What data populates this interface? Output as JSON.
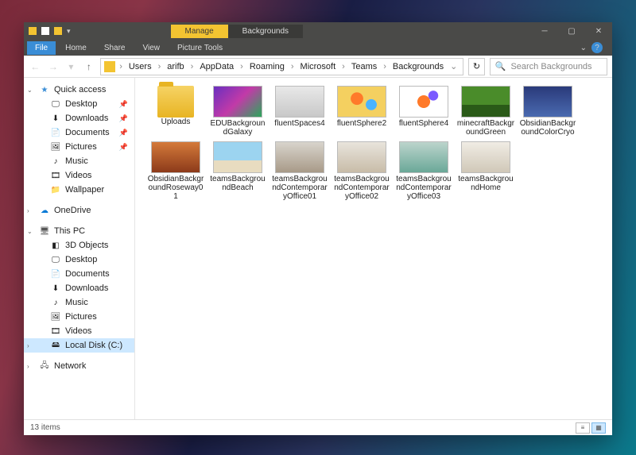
{
  "titlebar": {
    "manage": "Manage",
    "contextTab": "Backgrounds"
  },
  "ribbon": {
    "file": "File",
    "home": "Home",
    "share": "Share",
    "view": "View",
    "pictureTools": "Picture Tools"
  },
  "breadcrumb": [
    "Users",
    "arifb",
    "AppData",
    "Roaming",
    "Microsoft",
    "Teams",
    "Backgrounds"
  ],
  "search": {
    "placeholder": "Search Backgrounds"
  },
  "sidebar": {
    "quick": {
      "label": "Quick access",
      "items": [
        {
          "label": "Desktop",
          "pin": true
        },
        {
          "label": "Downloads",
          "pin": true
        },
        {
          "label": "Documents",
          "pin": true
        },
        {
          "label": "Pictures",
          "pin": true
        },
        {
          "label": "Music",
          "pin": false
        },
        {
          "label": "Videos",
          "pin": false
        },
        {
          "label": "Wallpaper",
          "pin": false
        }
      ]
    },
    "onedrive": "OneDrive",
    "thispc": {
      "label": "This PC",
      "items": [
        "3D Objects",
        "Desktop",
        "Documents",
        "Downloads",
        "Music",
        "Pictures",
        "Videos",
        "Local Disk (C:)"
      ]
    },
    "network": "Network"
  },
  "files": [
    {
      "name": "Uploads",
      "type": "folder"
    },
    {
      "name": "EDUBackgroundGalaxy",
      "tint": "t-galaxy"
    },
    {
      "name": "fluentSpaces4",
      "tint": "t-spaces"
    },
    {
      "name": "fluentSphere2",
      "tint": "t-sphere2"
    },
    {
      "name": "fluentSphere4",
      "tint": "t-sphere4"
    },
    {
      "name": "minecraftBackgroundGreen",
      "tint": "t-minecraft"
    },
    {
      "name": "ObsidianBackgroundColorCryo",
      "tint": "t-cryo"
    },
    {
      "name": "ObsidianBackgroundRoseway01",
      "tint": "t-rose"
    },
    {
      "name": "teamsBackgroundBeach",
      "tint": "t-beach"
    },
    {
      "name": "teamsBackgroundContemporaryOffice01",
      "tint": "t-off1"
    },
    {
      "name": "teamsBackgroundContemporaryOffice02",
      "tint": "t-off2"
    },
    {
      "name": "teamsBackgroundContemporaryOffice03",
      "tint": "t-off3"
    },
    {
      "name": "teamsBackgroundHome",
      "tint": "t-home"
    }
  ],
  "status": {
    "count": "13 items"
  }
}
